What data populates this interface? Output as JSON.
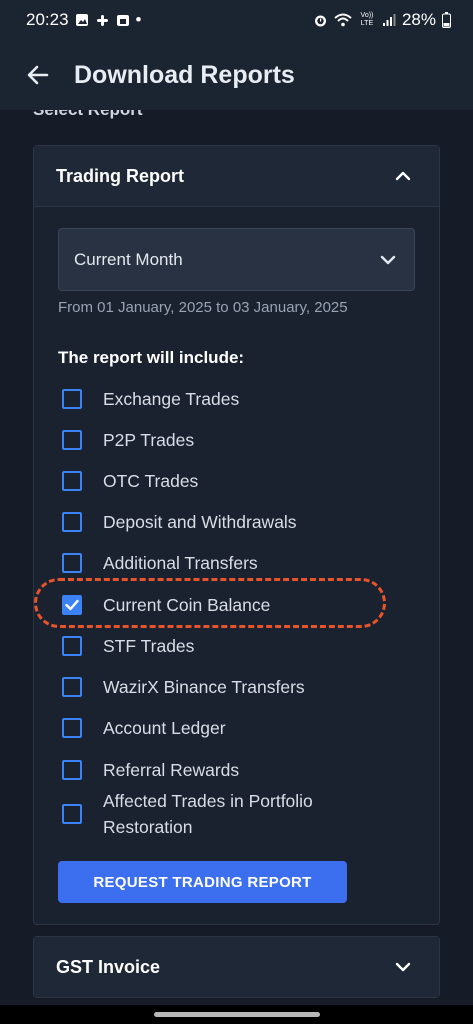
{
  "status_bar": {
    "time": "20:23",
    "dot": "•",
    "network_label": "Vo)) LTE",
    "battery_percent": "28%",
    "icons": [
      "image-icon",
      "slack-icon",
      "calendar-icon",
      "alarm-icon",
      "wifi-icon",
      "signal-icon",
      "battery-icon"
    ]
  },
  "app_bar": {
    "title": "Download Reports",
    "back_icon": "arrow-left-icon"
  },
  "section_label": "Select Report",
  "trading_card": {
    "title": "Trading Report",
    "expanded": true,
    "chevron_icon": "chevron-up-icon",
    "period_dropdown": {
      "selected": "Current Month",
      "icon": "chevron-down-icon"
    },
    "date_range": "From 01 January, 2025 to 03 January, 2025",
    "include_title": "The report will include:",
    "options": [
      {
        "label": "Exchange Trades",
        "checked": false
      },
      {
        "label": "P2P Trades",
        "checked": false
      },
      {
        "label": "OTC Trades",
        "checked": false
      },
      {
        "label": "Deposit and Withdrawals",
        "checked": false
      },
      {
        "label": "Additional Transfers",
        "checked": false
      },
      {
        "label": "Current Coin Balance",
        "checked": true
      },
      {
        "label": "STF Trades",
        "checked": false
      },
      {
        "label": "WazirX Binance Transfers",
        "checked": false
      },
      {
        "label": "Account Ledger",
        "checked": false
      },
      {
        "label": "Referral Rewards",
        "checked": false
      },
      {
        "label": "Affected Trades in Portfolio Restoration",
        "label_line1": "Affected Trades in Portfolio",
        "label_line2": "Restoration",
        "checked": false
      }
    ],
    "request_button": "REQUEST TRADING REPORT"
  },
  "gst_card": {
    "title": "GST Invoice",
    "expanded": false,
    "chevron_icon": "chevron-down-icon"
  },
  "colors": {
    "accent": "#3b82f6",
    "button": "#3b6ff0",
    "highlight": "#e8542a",
    "background": "#151c27",
    "card": "#1a2230"
  }
}
